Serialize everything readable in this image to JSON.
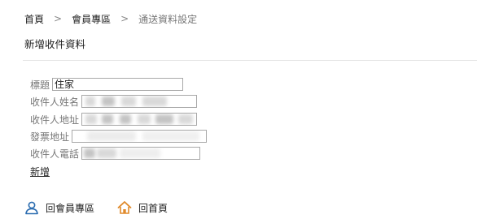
{
  "breadcrumb": {
    "home": "首頁",
    "member": "會員專區",
    "current": "通送資料設定",
    "separator": ">"
  },
  "page_title": "新增收件資料",
  "form": {
    "title_label": "標題",
    "title_value": "住家",
    "name_label": "收件人姓名",
    "address_label": "收件人地址",
    "invoice_label": "發票地址",
    "phone_label": "收件人電話"
  },
  "add_label": "新增",
  "bottom_links": {
    "member_label": "回會員專區",
    "home_label": "回首頁"
  },
  "icons": {
    "member_icon": "user-icon",
    "home_icon": "house-icon"
  },
  "colors": {
    "icon_blue": "#2b6cb0",
    "icon_orange": "#e08a2b"
  }
}
